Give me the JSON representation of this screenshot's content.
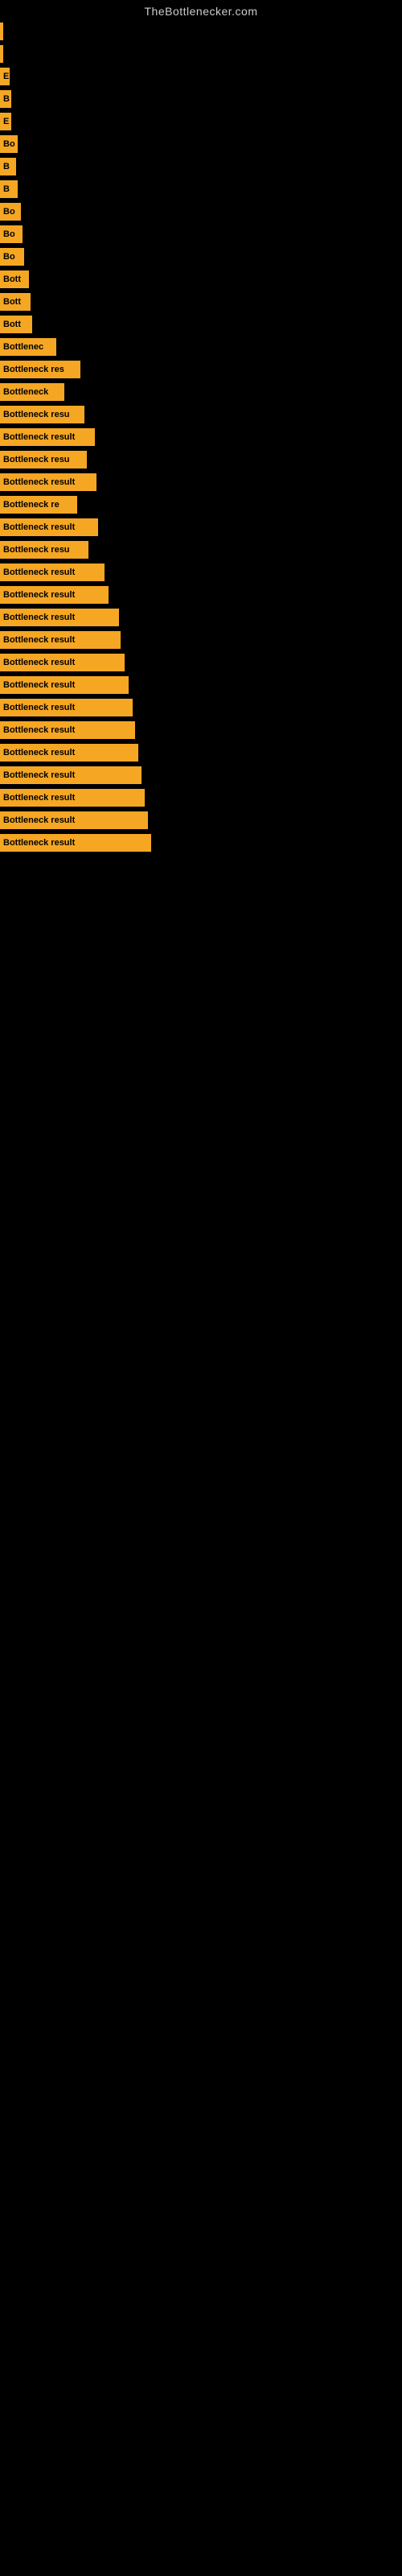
{
  "site": {
    "title": "TheBottlenecker.com"
  },
  "bars": [
    {
      "label": "",
      "width": 4
    },
    {
      "label": "",
      "width": 4
    },
    {
      "label": "E",
      "width": 12
    },
    {
      "label": "B",
      "width": 14
    },
    {
      "label": "E",
      "width": 14
    },
    {
      "label": "Bo",
      "width": 22
    },
    {
      "label": "B",
      "width": 20
    },
    {
      "label": "B",
      "width": 22
    },
    {
      "label": "Bo",
      "width": 26
    },
    {
      "label": "Bo",
      "width": 28
    },
    {
      "label": "Bo",
      "width": 30
    },
    {
      "label": "Bott",
      "width": 36
    },
    {
      "label": "Bott",
      "width": 38
    },
    {
      "label": "Bott",
      "width": 40
    },
    {
      "label": "Bottlenec",
      "width": 70
    },
    {
      "label": "Bottleneck res",
      "width": 100
    },
    {
      "label": "Bottleneck",
      "width": 80
    },
    {
      "label": "Bottleneck resu",
      "width": 105
    },
    {
      "label": "Bottleneck result",
      "width": 118
    },
    {
      "label": "Bottleneck resu",
      "width": 108
    },
    {
      "label": "Bottleneck result",
      "width": 120
    },
    {
      "label": "Bottleneck re",
      "width": 96
    },
    {
      "label": "Bottleneck result",
      "width": 122
    },
    {
      "label": "Bottleneck resu",
      "width": 110
    },
    {
      "label": "Bottleneck result",
      "width": 130
    },
    {
      "label": "Bottleneck result",
      "width": 135
    },
    {
      "label": "Bottleneck result",
      "width": 148
    },
    {
      "label": "Bottleneck result",
      "width": 150
    },
    {
      "label": "Bottleneck result",
      "width": 155
    },
    {
      "label": "Bottleneck result",
      "width": 160
    },
    {
      "label": "Bottleneck result",
      "width": 165
    },
    {
      "label": "Bottleneck result",
      "width": 168
    },
    {
      "label": "Bottleneck result",
      "width": 172
    },
    {
      "label": "Bottleneck result",
      "width": 176
    },
    {
      "label": "Bottleneck result",
      "width": 180
    },
    {
      "label": "Bottleneck result",
      "width": 184
    },
    {
      "label": "Bottleneck result",
      "width": 188
    }
  ]
}
